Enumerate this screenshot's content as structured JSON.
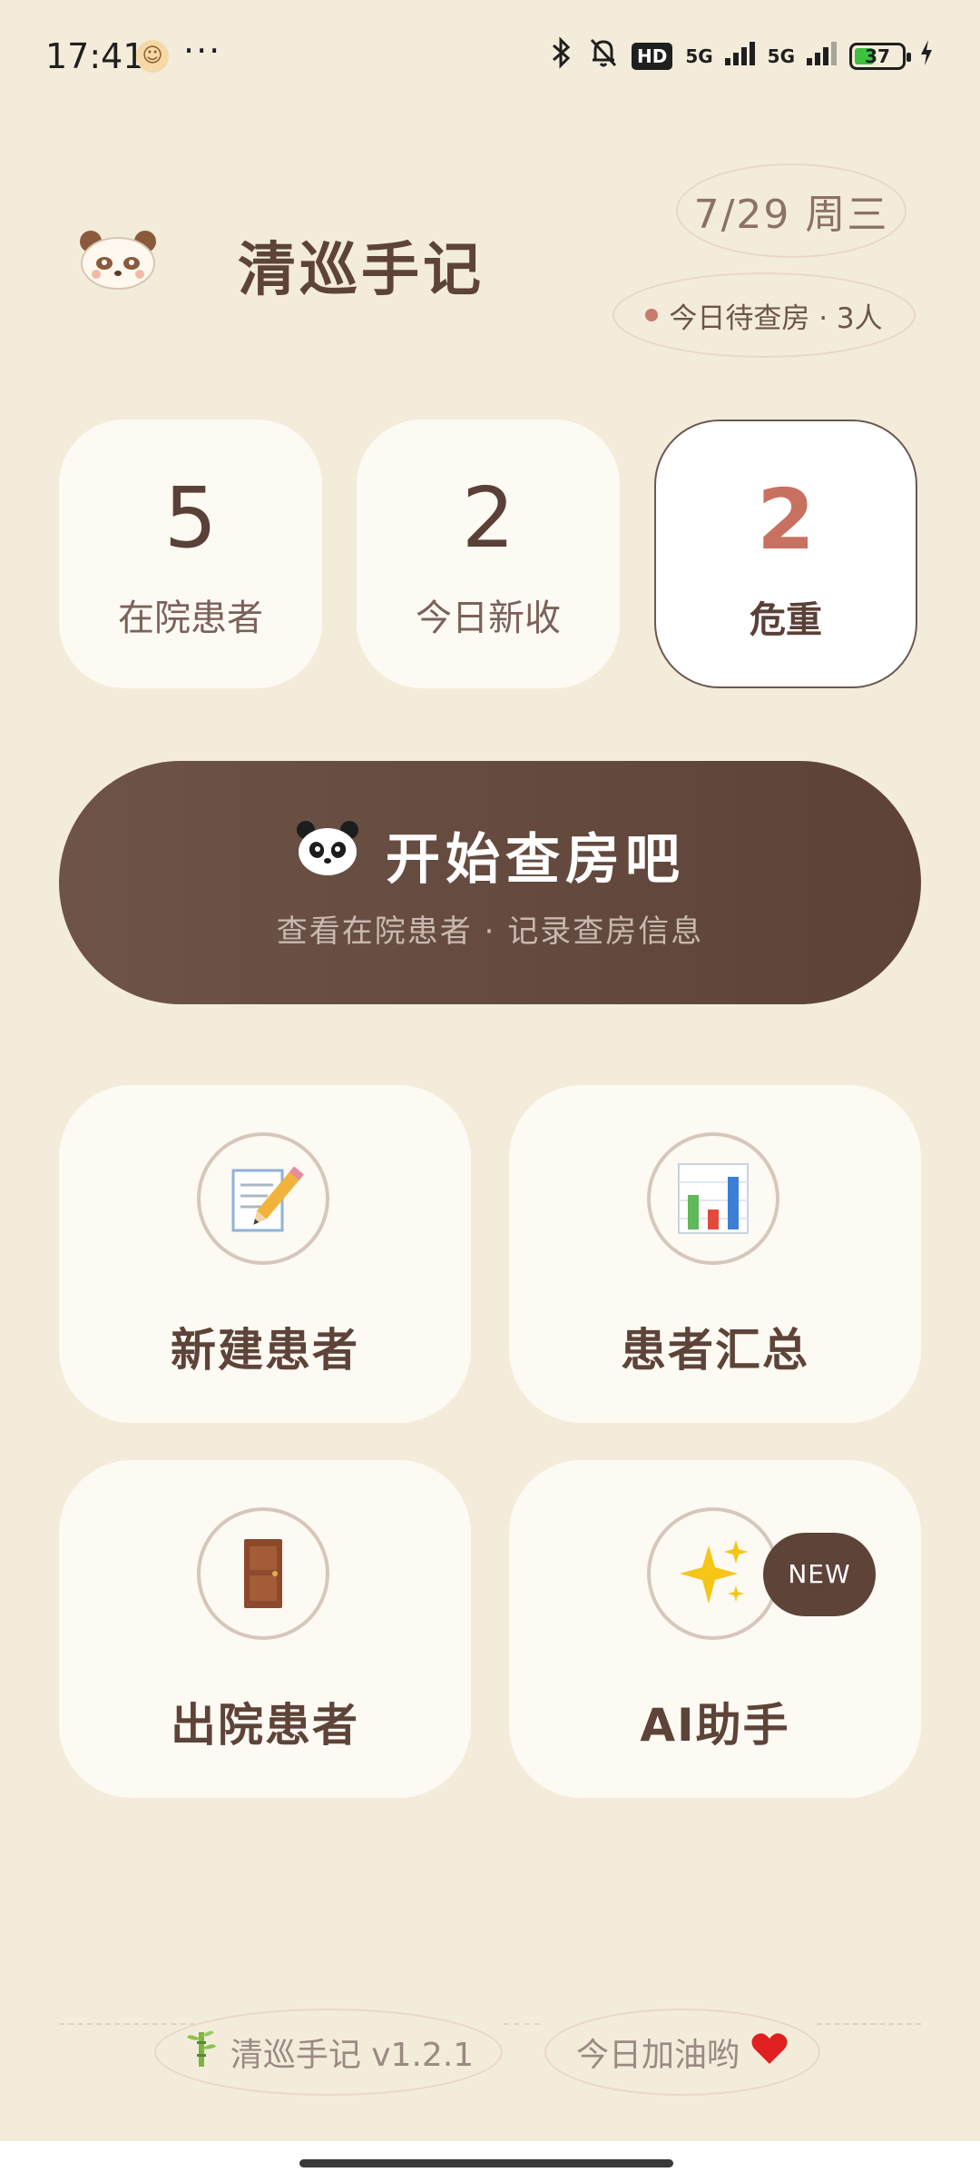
{
  "status_bar": {
    "time": "17:41",
    "more": "···",
    "hd_label": "HD",
    "network_1": "5G",
    "network_2": "5G",
    "battery": "37"
  },
  "header": {
    "title": "清巡手记",
    "date": "7/29 周三",
    "pending_rounds": "今日待查房 · 3人"
  },
  "stats": [
    {
      "value": "5",
      "label": "在院患者"
    },
    {
      "value": "2",
      "label": "今日新收"
    },
    {
      "value": "2",
      "label": "危重"
    }
  ],
  "cta": {
    "title": "开始查房吧",
    "subtitle": "查看在院患者 · 记录查房信息"
  },
  "actions": [
    {
      "label": "新建患者",
      "icon": "memo-pencil-icon"
    },
    {
      "label": "患者汇总",
      "icon": "bar-chart-icon"
    },
    {
      "label": "出院患者",
      "icon": "door-icon"
    },
    {
      "label": "AI助手",
      "icon": "sparkles-icon",
      "badge": "NEW"
    }
  ],
  "footer": {
    "version": "清巡手记 v1.2.1",
    "cheer": "今日加油哟"
  },
  "colors": {
    "background": "#f3ecdb",
    "card": "#fdfaf3",
    "primary_brown": "#5e4338",
    "critical_accent": "#c97160"
  }
}
